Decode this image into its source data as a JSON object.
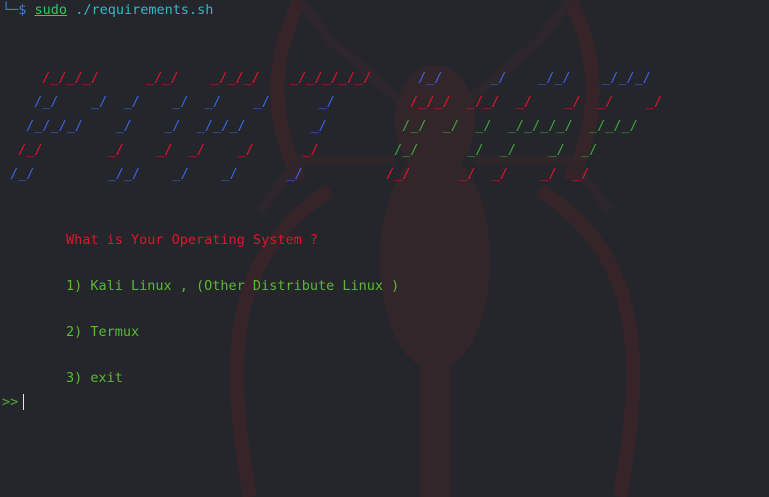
{
  "terminal": {
    "prompt_corner": "└─",
    "prompt_symbol": "$",
    "command_sudo": "sudo",
    "command_path": "./requirements.sh"
  },
  "banner": {
    "group1_red": [
      "/_/_/_/",
      "_/_/",
      "_/_/_/",
      "_/_/_/_/_/",
      "_/",
      "_/",
      "_/",
      "_/",
      "_/",
      "_/"
    ],
    "group1_blue": [
      "/_/",
      "/_/_/_/",
      "/_/",
      "_/_/_/",
      "_/",
      "_/_/",
      "_/",
      "_/",
      "_/"
    ]
  },
  "menu": {
    "title": "What is Your Operating System ?",
    "option1": "1) Kali Linux , (Other Distribute Linux )",
    "option2": "2) Termux",
    "option3": "3) exit"
  },
  "input": {
    "prompt": ">>"
  },
  "colors": {
    "background": "#25262b",
    "red": "#e0152b",
    "blue": "#3766e6",
    "green": "#3ca83a",
    "menu_green": "#5cb833"
  }
}
